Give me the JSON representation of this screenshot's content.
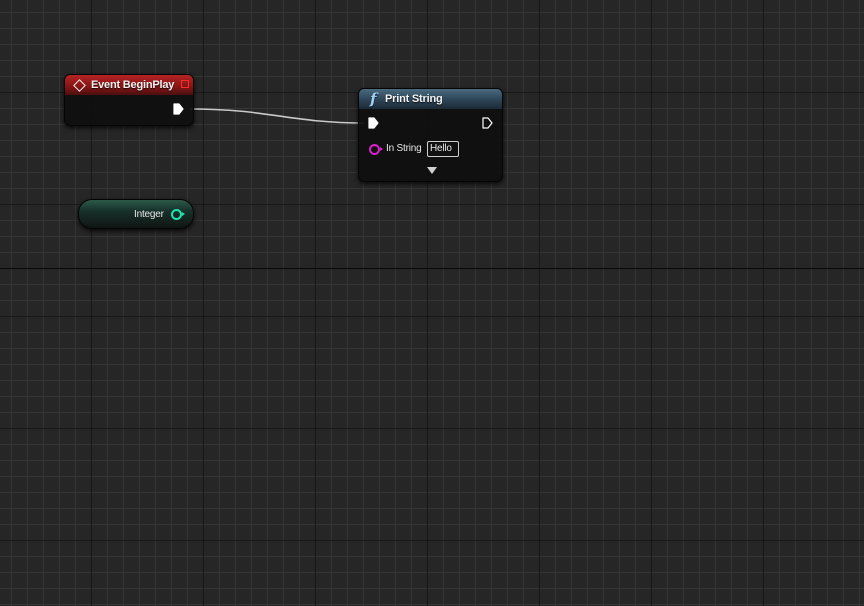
{
  "graph": {
    "background": "#262626"
  },
  "nodes": {
    "event_begin_play": {
      "title": "Event BeginPlay",
      "icon": "event-diamond-icon",
      "header_color": "#841414",
      "delegate_pin_color": "#ff2a2a",
      "exec_out_connected": true
    },
    "print_string": {
      "title": "Print String",
      "icon": "function-icon",
      "icon_glyph": "f",
      "header_color": "#2c4456",
      "exec_in_connected": true,
      "exec_out_connected": false,
      "in_string_label": "In String",
      "in_string_value": "Hello",
      "string_pin_color": "#d91fcf",
      "expand_icon": "chevron-down-icon"
    },
    "integer_variable": {
      "label": "Integer",
      "pin_color": "#1fe3ae"
    }
  },
  "wires": [
    {
      "from": "event_begin_play.exec_out",
      "to": "print_string.exec_in",
      "color": "#e6e6e6"
    }
  ]
}
